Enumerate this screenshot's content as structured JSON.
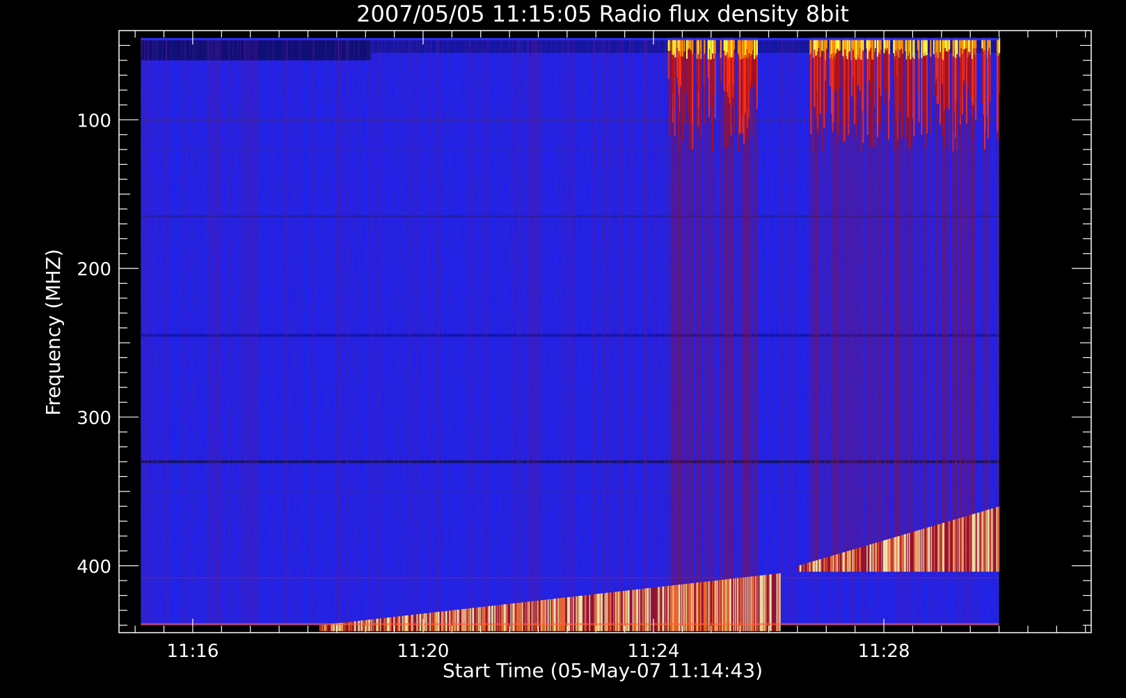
{
  "chart_data": {
    "type": "heatmap",
    "title": "2007/05/05 11:15:05 Radio flux density 8bit",
    "xlabel": "Start Time (05-May-07 11:14:43)",
    "ylabel": "Frequency (MHZ)",
    "x_ticks": [
      "11:16",
      "11:20",
      "11:24",
      "11:28"
    ],
    "y_ticks": [
      "100",
      "200",
      "300",
      "400"
    ],
    "x_range_minutes_after_11_00": [
      14.72,
      31.6
    ],
    "data_range_minutes_after_11_00": [
      15.1,
      30.0
    ],
    "x_tick_values_minutes_after_11_00": [
      16,
      20,
      24,
      28
    ],
    "y_range_mhz": [
      40,
      445
    ],
    "data_range_mhz": [
      45,
      440
    ],
    "y_tick_values_mhz": [
      100,
      200,
      300,
      400
    ],
    "y_axis_inverted": true,
    "grid": false,
    "background_color": "#1a1aff",
    "colormap": [
      "#000040",
      "#1a1aff",
      "#8a0000",
      "#ff2000",
      "#ff9000",
      "#ffff40",
      "#ffffff"
    ],
    "features": [
      {
        "name": "Type II emission band (lower)",
        "t_start": 18.2,
        "t_end": 26.2,
        "f_start": 440,
        "f_end": 405
      },
      {
        "name": "Type II emission band (upper)",
        "t_start": 26.5,
        "t_end": 30.0,
        "f_start": 400,
        "f_end": 360
      },
      {
        "name": "Type III burst group 1",
        "t_start": 24.2,
        "t_end": 25.8,
        "f_high": 45,
        "f_low": 440
      },
      {
        "name": "Type III burst group 2",
        "t_start": 26.7,
        "t_end": 30.0,
        "f_high": 45,
        "f_low": 400
      }
    ]
  }
}
